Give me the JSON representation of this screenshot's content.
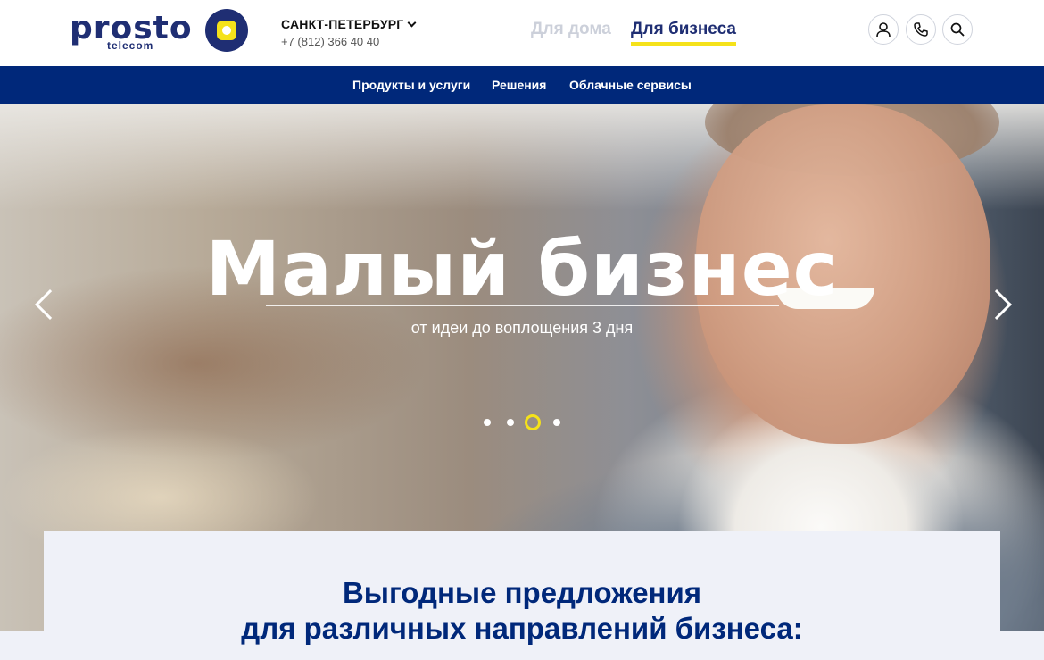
{
  "header": {
    "logo": {
      "word": "prosto",
      "sub": "telecom"
    },
    "city": "САНКТ-ПЕТЕРБУРГ",
    "phone": "+7 (812) 366 40 40",
    "segments": {
      "home": "Для дома",
      "business": "Для бизнеса"
    },
    "icons": [
      "user-icon",
      "phone-icon",
      "search-icon"
    ]
  },
  "nav": {
    "items": [
      {
        "label": "Продукты и услуги"
      },
      {
        "label": "Решения"
      },
      {
        "label": "Облачные сервисы"
      }
    ]
  },
  "hero": {
    "title": "Малый бизнес",
    "subtitle": "от идеи до воплощения 3 дня",
    "slides_count": 4,
    "active_slide": 3
  },
  "offers": {
    "title_line1": "Выгодные предложения",
    "title_line2": "для различных направлений бизнеса:"
  },
  "colors": {
    "brand_navy": "#00287a",
    "logo_navy": "#1f2e73",
    "accent_yellow": "#f5e21a",
    "offers_bg": "#eff1f8"
  }
}
